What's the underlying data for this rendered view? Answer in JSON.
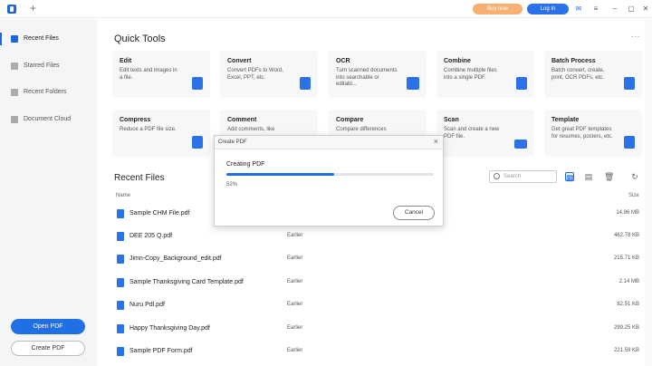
{
  "titlebar": {
    "buy_label": "Buy now",
    "login_label": "Log In"
  },
  "sidebar": {
    "items": [
      {
        "label": "Recent Files",
        "icon": "clock-icon",
        "active": true
      },
      {
        "label": "Starred Files",
        "icon": "star-icon",
        "active": false
      },
      {
        "label": "Recent Folders",
        "icon": "folder-icon",
        "active": false
      },
      {
        "label": "Document Cloud",
        "icon": "cloud-icon",
        "active": false
      }
    ],
    "open_pdf_label": "Open PDF",
    "create_pdf_label": "Create PDF"
  },
  "quick_tools": {
    "title": "Quick Tools",
    "cards": [
      {
        "title": "Edit",
        "desc": "Edit texts and images in a file.",
        "color": "#2a72e6"
      },
      {
        "title": "Convert",
        "desc": "Convert PDFs to Word, Excel, PPT, etc.",
        "color": "#2a72e6"
      },
      {
        "title": "OCR",
        "desc": "Turn scanned documents into searchable or editabl...",
        "color": "#2a72e6"
      },
      {
        "title": "Combine",
        "desc": "Combine multiple files into a single PDF.",
        "color": "#2a72e6"
      },
      {
        "title": "Batch Process",
        "desc": "Batch convert, create, print, OCR PDFs, etc.",
        "color": "#2a72e6"
      },
      {
        "title": "Compress",
        "desc": "Reduce a PDF file size.",
        "color": "#2a72e6"
      },
      {
        "title": "Comment",
        "desc": "Add comments, like",
        "color": "#2a72e6"
      },
      {
        "title": "Compare",
        "desc": "Compare differences",
        "color": "#2a72e6"
      },
      {
        "title": "Scan",
        "desc": "Scan and create a new PDF file.",
        "color": "#2a72e6"
      },
      {
        "title": "Template",
        "desc": "Get great PDF templates for resumes, posters, etc.",
        "color": "#2a72e6"
      }
    ]
  },
  "recent_files": {
    "title": "Recent Files",
    "search_placeholder": "Search",
    "columns": {
      "name": "Name",
      "size": "Size"
    },
    "rows": [
      {
        "name": "Sample CHM File.pdf",
        "date": "",
        "size": "14.96 MB"
      },
      {
        "name": "DEE 205 Q.pdf",
        "date": "Earlier",
        "size": "462.78 KB"
      },
      {
        "name": "Jimn-Copy_Background_edit.pdf",
        "date": "Earlier",
        "size": "215.71 KB"
      },
      {
        "name": "Sample Thanksgiving Card Template.pdf",
        "date": "Earlier",
        "size": "2.14 MB"
      },
      {
        "name": "Nuru Pdl.pdf",
        "date": "Earlier",
        "size": "82.51 KB"
      },
      {
        "name": "Happy Thanksgiving Day.pdf",
        "date": "Earlier",
        "size": "299.25 KB"
      },
      {
        "name": "Sample PDF Form.pdf",
        "date": "Earlier",
        "size": "221.59 KB"
      }
    ]
  },
  "dialog": {
    "title": "Create PDF",
    "label": "Creating PDF",
    "progress_text": "52%",
    "progress": 0.52,
    "cancel_label": "Cancel"
  },
  "colors": {
    "accent": "#1f6fe5",
    "buy": "#f6b072"
  }
}
